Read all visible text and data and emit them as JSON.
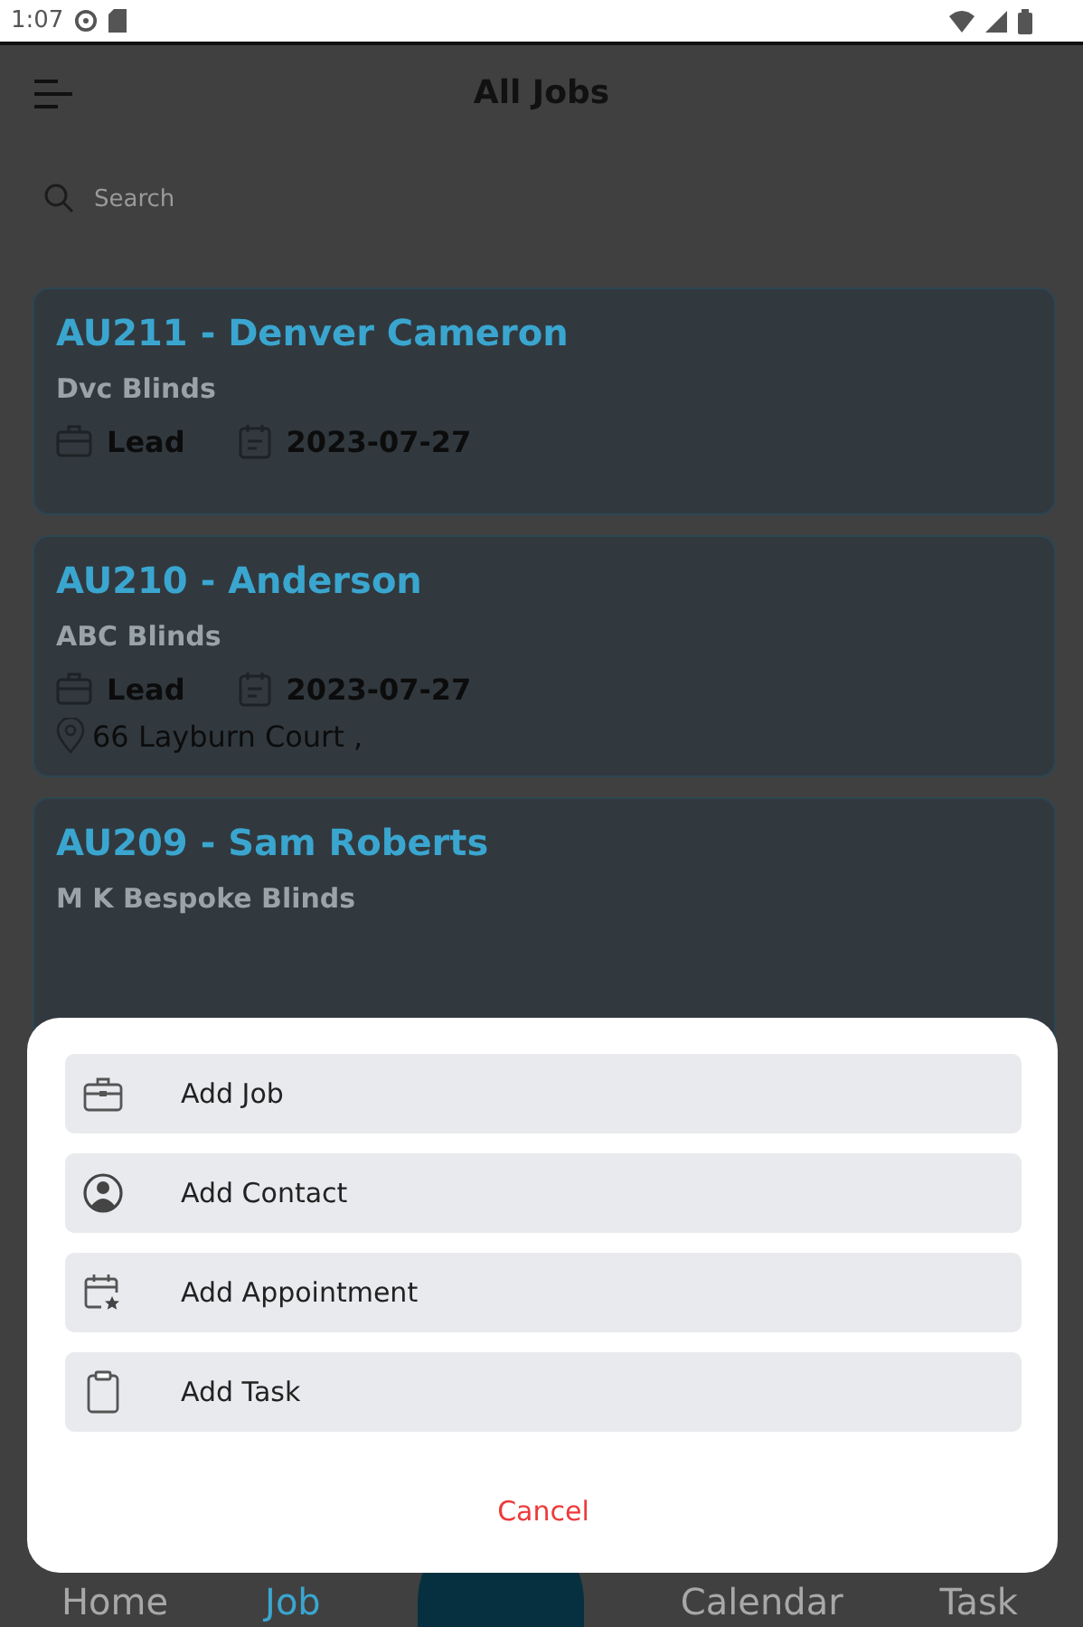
{
  "status_bar": {
    "time": "1:07"
  },
  "app_bar": {
    "title": "All Jobs"
  },
  "search": {
    "placeholder": "Search"
  },
  "jobs": [
    {
      "title": "AU211 - Denver Cameron",
      "company": "Dvc Blinds",
      "stage": "Lead",
      "date": "2023-07-27"
    },
    {
      "title": "AU210 - Anderson",
      "company": "ABC Blinds",
      "stage": "Lead",
      "date": "2023-07-27",
      "address": "66 Layburn Court ,"
    },
    {
      "title": "AU209 - Sam Roberts",
      "company": "M K Bespoke Blinds"
    }
  ],
  "bottom_nav": [
    {
      "label": "Home",
      "selected": false
    },
    {
      "label": "Job",
      "selected": true
    },
    {
      "label": "Calendar",
      "selected": false
    },
    {
      "label": "Task",
      "selected": false
    }
  ],
  "sheet": {
    "actions": [
      {
        "kind": "job",
        "label": "Add Job"
      },
      {
        "kind": "contact",
        "label": "Add Contact"
      },
      {
        "kind": "appointment",
        "label": "Add Appointment"
      },
      {
        "kind": "task",
        "label": "Add Task"
      }
    ],
    "cancel": "Cancel"
  }
}
